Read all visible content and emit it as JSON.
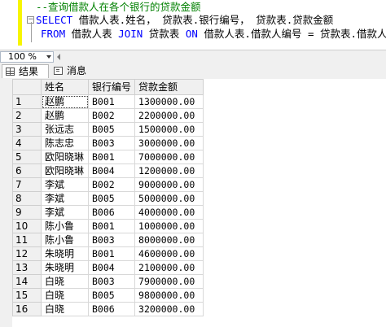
{
  "editor": {
    "comment_line": "--查询借款人在各个银行的贷款金额",
    "select_keyword": "SELECT",
    "select_columns": " 借款人表.姓名， 贷款表.银行编号， 贷款表.贷款金额",
    "from_keyword": "FROM",
    "from_table": " 借款人表 ",
    "join_keyword": "JOIN",
    "join_table": " 贷款表 ",
    "on_keyword": "ON",
    "on_condition": " 借款人表.借款人编号 = 贷款表.借款人编号;",
    "outline_symbol": "−"
  },
  "zoom": {
    "value": "100 %"
  },
  "tabs": {
    "results_label": "结果",
    "messages_label": "消息"
  },
  "results": {
    "columns": [
      "姓名",
      "银行编号",
      "贷款金额"
    ],
    "rows": [
      {
        "n": "1",
        "name": "赵鹏",
        "bank": "B001",
        "amount": "1300000.00"
      },
      {
        "n": "2",
        "name": "赵鹏",
        "bank": "B002",
        "amount": "2200000.00"
      },
      {
        "n": "3",
        "name": "张远志",
        "bank": "B005",
        "amount": "1500000.00"
      },
      {
        "n": "4",
        "name": "陈志忠",
        "bank": "B003",
        "amount": "3000000.00"
      },
      {
        "n": "5",
        "name": "欧阳晓琳",
        "bank": "B001",
        "amount": "7000000.00"
      },
      {
        "n": "6",
        "name": "欧阳晓琳",
        "bank": "B004",
        "amount": "1200000.00"
      },
      {
        "n": "7",
        "name": "李斌",
        "bank": "B002",
        "amount": "9000000.00"
      },
      {
        "n": "8",
        "name": "李斌",
        "bank": "B005",
        "amount": "5000000.00"
      },
      {
        "n": "9",
        "name": "李斌",
        "bank": "B006",
        "amount": "4000000.00"
      },
      {
        "n": "10",
        "name": "陈小鲁",
        "bank": "B001",
        "amount": "1000000.00"
      },
      {
        "n": "11",
        "name": "陈小鲁",
        "bank": "B003",
        "amount": "8000000.00"
      },
      {
        "n": "12",
        "name": "朱晓明",
        "bank": "B001",
        "amount": "4600000.00"
      },
      {
        "n": "13",
        "name": "朱晓明",
        "bank": "B004",
        "amount": "2100000.00"
      },
      {
        "n": "14",
        "name": "白晓",
        "bank": "B003",
        "amount": "7900000.00"
      },
      {
        "n": "15",
        "name": "白晓",
        "bank": "B005",
        "amount": "9800000.00"
      },
      {
        "n": "16",
        "name": "白晓",
        "bank": "B006",
        "amount": "3200000.00"
      }
    ]
  },
  "colors": {
    "change_bar": "#f7f500",
    "keyword": "#0000ff",
    "comment": "#008000",
    "operator": "#808080",
    "header_bg": "#f0f0f0"
  },
  "icons": {
    "results_tab": "grid-icon",
    "messages_tab": "message-icon",
    "outline": "collapse-icon",
    "zoom_dropdown": "chevron-down-icon"
  }
}
